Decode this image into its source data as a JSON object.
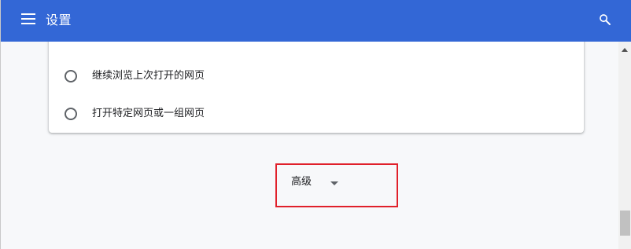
{
  "header": {
    "title": "设置",
    "menu_icon": "menu-icon",
    "search_icon": "search-icon",
    "background_color": "#3367d6"
  },
  "startup_options": [
    {
      "label": "",
      "checked": true
    },
    {
      "label": "继续浏览上次打开的网页",
      "checked": false
    },
    {
      "label": "打开特定网页或一组网页",
      "checked": false
    }
  ],
  "advanced": {
    "label": "高级",
    "icon": "dropdown-arrow-icon",
    "highlight_color": "#e0202a"
  }
}
